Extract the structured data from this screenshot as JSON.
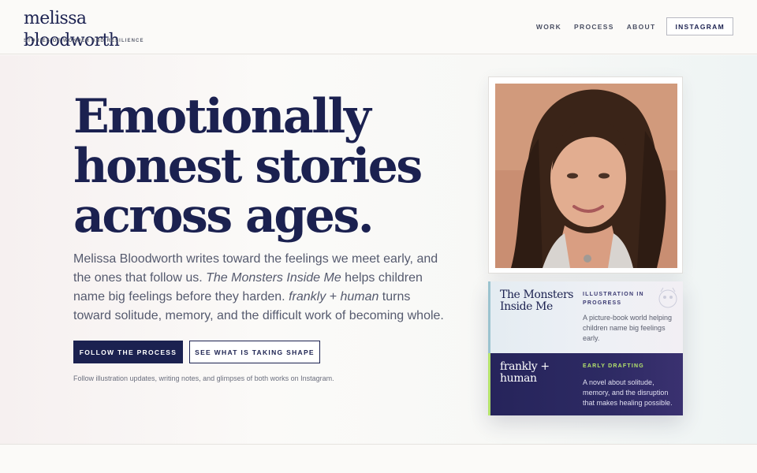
{
  "header": {
    "brand_name": "melissa bloodworth",
    "brand_tagline": "STORIES OF WONDER AND RESILIENCE",
    "nav": [
      "WORK",
      "PROCESS",
      "ABOUT"
    ],
    "instagram_label": "INSTAGRAM"
  },
  "hero": {
    "headline": [
      "Emotionally",
      "honest stories",
      "across ages."
    ],
    "lead": {
      "part1": "Melissa Bloodworth writes toward the feelings we meet early, and the ones that follow us. ",
      "title1": "The Monsters Inside Me",
      "part2": " helps children name big feelings before they harden. ",
      "title2": "frankly + human",
      "part3": " turns toward solitude, memory, and the difficult work of becoming whole."
    },
    "primary_cta": "FOLLOW THE PROCESS",
    "secondary_cta": "SEE WHAT IS TAKING SHAPE",
    "note": "Follow illustration updates, writing notes, and glimpses of both works on Instagram."
  },
  "works": [
    {
      "title": "The Monsters Inside Me",
      "status": "ILLUSTRATION IN PROGRESS",
      "description": "A picture-book world helping children name big feelings early."
    },
    {
      "title": "frankly + human",
      "status": "EARLY DRAFTING",
      "description": "A novel about solitude, memory, and the disruption that makes healing possible."
    }
  ],
  "colors": {
    "navy": "#1b2150",
    "accent_teal": "#9bc3cf",
    "accent_lime": "#b4e36b",
    "purple_card": "#2b2860"
  }
}
